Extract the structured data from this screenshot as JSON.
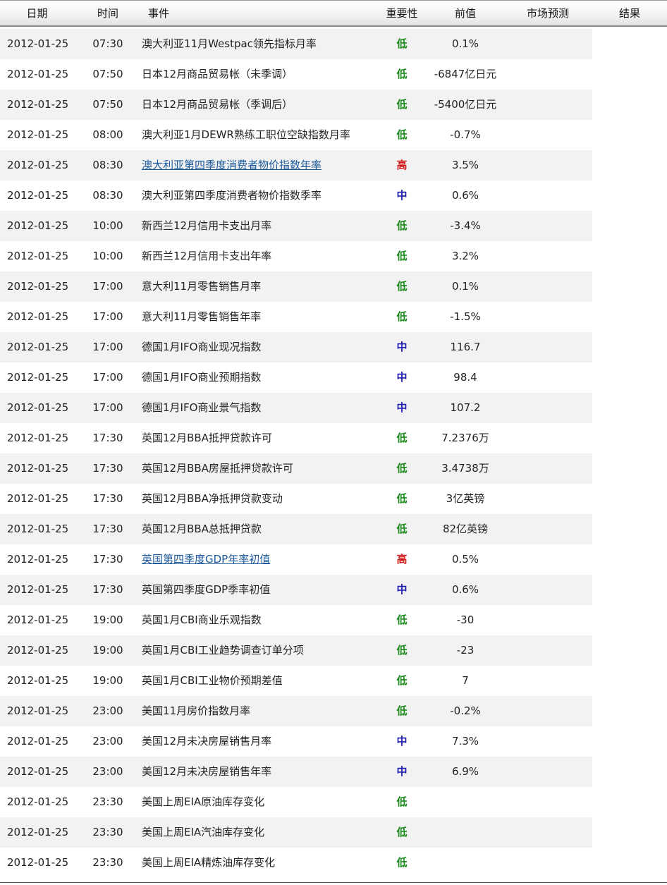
{
  "header": {
    "date": "日期",
    "time": "时间",
    "event": "事件",
    "importance": "重要性",
    "previous": "前值",
    "forecast": "市场预测",
    "result": "结果"
  },
  "colors": {
    "low": "#1a8a1a",
    "medium": "#1c1cb0",
    "high": "#d01818",
    "link": "#1a5a9c",
    "row_alt": "#f2f2f2"
  },
  "rows": [
    {
      "date": "2012-01-25",
      "time": "07:30",
      "event": "澳大利亚11月Westpac领先指标月率",
      "importance": "低",
      "level": "low",
      "previous": "0.1%",
      "forecast": "",
      "result": "",
      "link": false
    },
    {
      "date": "2012-01-25",
      "time": "07:50",
      "event": "日本12月商品贸易帐（未季调）",
      "importance": "低",
      "level": "low",
      "previous": "-6847亿日元",
      "forecast": "",
      "result": "",
      "link": false
    },
    {
      "date": "2012-01-25",
      "time": "07:50",
      "event": "日本12月商品贸易帐（季调后）",
      "importance": "低",
      "level": "low",
      "previous": "-5400亿日元",
      "forecast": "",
      "result": "",
      "link": false
    },
    {
      "date": "2012-01-25",
      "time": "08:00",
      "event": "澳大利亚1月DEWR熟练工职位空缺指数月率",
      "importance": "低",
      "level": "low",
      "previous": "-0.7%",
      "forecast": "",
      "result": "",
      "link": false
    },
    {
      "date": "2012-01-25",
      "time": "08:30",
      "event": "澳大利亚第四季度消费者物价指数年率",
      "importance": "高",
      "level": "high",
      "previous": "3.5%",
      "forecast": "",
      "result": "",
      "link": true
    },
    {
      "date": "2012-01-25",
      "time": "08:30",
      "event": "澳大利亚第四季度消费者物价指数季率",
      "importance": "中",
      "level": "medium",
      "previous": "0.6%",
      "forecast": "",
      "result": "",
      "link": false
    },
    {
      "date": "2012-01-25",
      "time": "10:00",
      "event": "新西兰12月信用卡支出月率",
      "importance": "低",
      "level": "low",
      "previous": "-3.4%",
      "forecast": "",
      "result": "",
      "link": false
    },
    {
      "date": "2012-01-25",
      "time": "10:00",
      "event": "新西兰12月信用卡支出年率",
      "importance": "低",
      "level": "low",
      "previous": "3.2%",
      "forecast": "",
      "result": "",
      "link": false
    },
    {
      "date": "2012-01-25",
      "time": "17:00",
      "event": "意大利11月零售销售月率",
      "importance": "低",
      "level": "low",
      "previous": "0.1%",
      "forecast": "",
      "result": "",
      "link": false
    },
    {
      "date": "2012-01-25",
      "time": "17:00",
      "event": "意大利11月零售销售年率",
      "importance": "低",
      "level": "low",
      "previous": "-1.5%",
      "forecast": "",
      "result": "",
      "link": false
    },
    {
      "date": "2012-01-25",
      "time": "17:00",
      "event": "德国1月IFO商业现况指数",
      "importance": "中",
      "level": "medium",
      "previous": "116.7",
      "forecast": "",
      "result": "",
      "link": false
    },
    {
      "date": "2012-01-25",
      "time": "17:00",
      "event": "德国1月IFO商业预期指数",
      "importance": "中",
      "level": "medium",
      "previous": "98.4",
      "forecast": "",
      "result": "",
      "link": false
    },
    {
      "date": "2012-01-25",
      "time": "17:00",
      "event": "德国1月IFO商业景气指数",
      "importance": "中",
      "level": "medium",
      "previous": "107.2",
      "forecast": "",
      "result": "",
      "link": false
    },
    {
      "date": "2012-01-25",
      "time": "17:30",
      "event": "英国12月BBA抵押贷款许可",
      "importance": "低",
      "level": "low",
      "previous": "7.2376万",
      "forecast": "",
      "result": "",
      "link": false
    },
    {
      "date": "2012-01-25",
      "time": "17:30",
      "event": "英国12月BBA房屋抵押贷款许可",
      "importance": "低",
      "level": "low",
      "previous": "3.4738万",
      "forecast": "",
      "result": "",
      "link": false
    },
    {
      "date": "2012-01-25",
      "time": "17:30",
      "event": "英国12月BBA净抵押贷款变动",
      "importance": "低",
      "level": "low",
      "previous": "3亿英镑",
      "forecast": "",
      "result": "",
      "link": false
    },
    {
      "date": "2012-01-25",
      "time": "17:30",
      "event": "英国12月BBA总抵押贷款",
      "importance": "低",
      "level": "low",
      "previous": "82亿英镑",
      "forecast": "",
      "result": "",
      "link": false
    },
    {
      "date": "2012-01-25",
      "time": "17:30",
      "event": "英国第四季度GDP年率初值",
      "importance": "高",
      "level": "high",
      "previous": "0.5%",
      "forecast": "",
      "result": "",
      "link": true
    },
    {
      "date": "2012-01-25",
      "time": "17:30",
      "event": "英国第四季度GDP季率初值",
      "importance": "中",
      "level": "medium",
      "previous": "0.6%",
      "forecast": "",
      "result": "",
      "link": false
    },
    {
      "date": "2012-01-25",
      "time": "19:00",
      "event": "英国1月CBI商业乐观指数",
      "importance": "低",
      "level": "low",
      "previous": "-30",
      "forecast": "",
      "result": "",
      "link": false
    },
    {
      "date": "2012-01-25",
      "time": "19:00",
      "event": "英国1月CBI工业趋势调查订单分项",
      "importance": "低",
      "level": "low",
      "previous": "-23",
      "forecast": "",
      "result": "",
      "link": false
    },
    {
      "date": "2012-01-25",
      "time": "19:00",
      "event": "英国1月CBI工业物价预期差值",
      "importance": "低",
      "level": "low",
      "previous": "7",
      "forecast": "",
      "result": "",
      "link": false
    },
    {
      "date": "2012-01-25",
      "time": "23:00",
      "event": "美国11月房价指数月率",
      "importance": "低",
      "level": "low",
      "previous": "-0.2%",
      "forecast": "",
      "result": "",
      "link": false
    },
    {
      "date": "2012-01-25",
      "time": "23:00",
      "event": "美国12月未决房屋销售月率",
      "importance": "中",
      "level": "medium",
      "previous": "7.3%",
      "forecast": "",
      "result": "",
      "link": false
    },
    {
      "date": "2012-01-25",
      "time": "23:00",
      "event": "美国12月未决房屋销售年率",
      "importance": "中",
      "level": "medium",
      "previous": "6.9%",
      "forecast": "",
      "result": "",
      "link": false
    },
    {
      "date": "2012-01-25",
      "time": "23:30",
      "event": "美国上周EIA原油库存变化",
      "importance": "低",
      "level": "low",
      "previous": "",
      "forecast": "",
      "result": "",
      "link": false
    },
    {
      "date": "2012-01-25",
      "time": "23:30",
      "event": "美国上周EIA汽油库存变化",
      "importance": "低",
      "level": "low",
      "previous": "",
      "forecast": "",
      "result": "",
      "link": false
    },
    {
      "date": "2012-01-25",
      "time": "23:30",
      "event": "美国上周EIA精炼油库存变化",
      "importance": "低",
      "level": "low",
      "previous": "",
      "forecast": "",
      "result": "",
      "link": false
    }
  ]
}
